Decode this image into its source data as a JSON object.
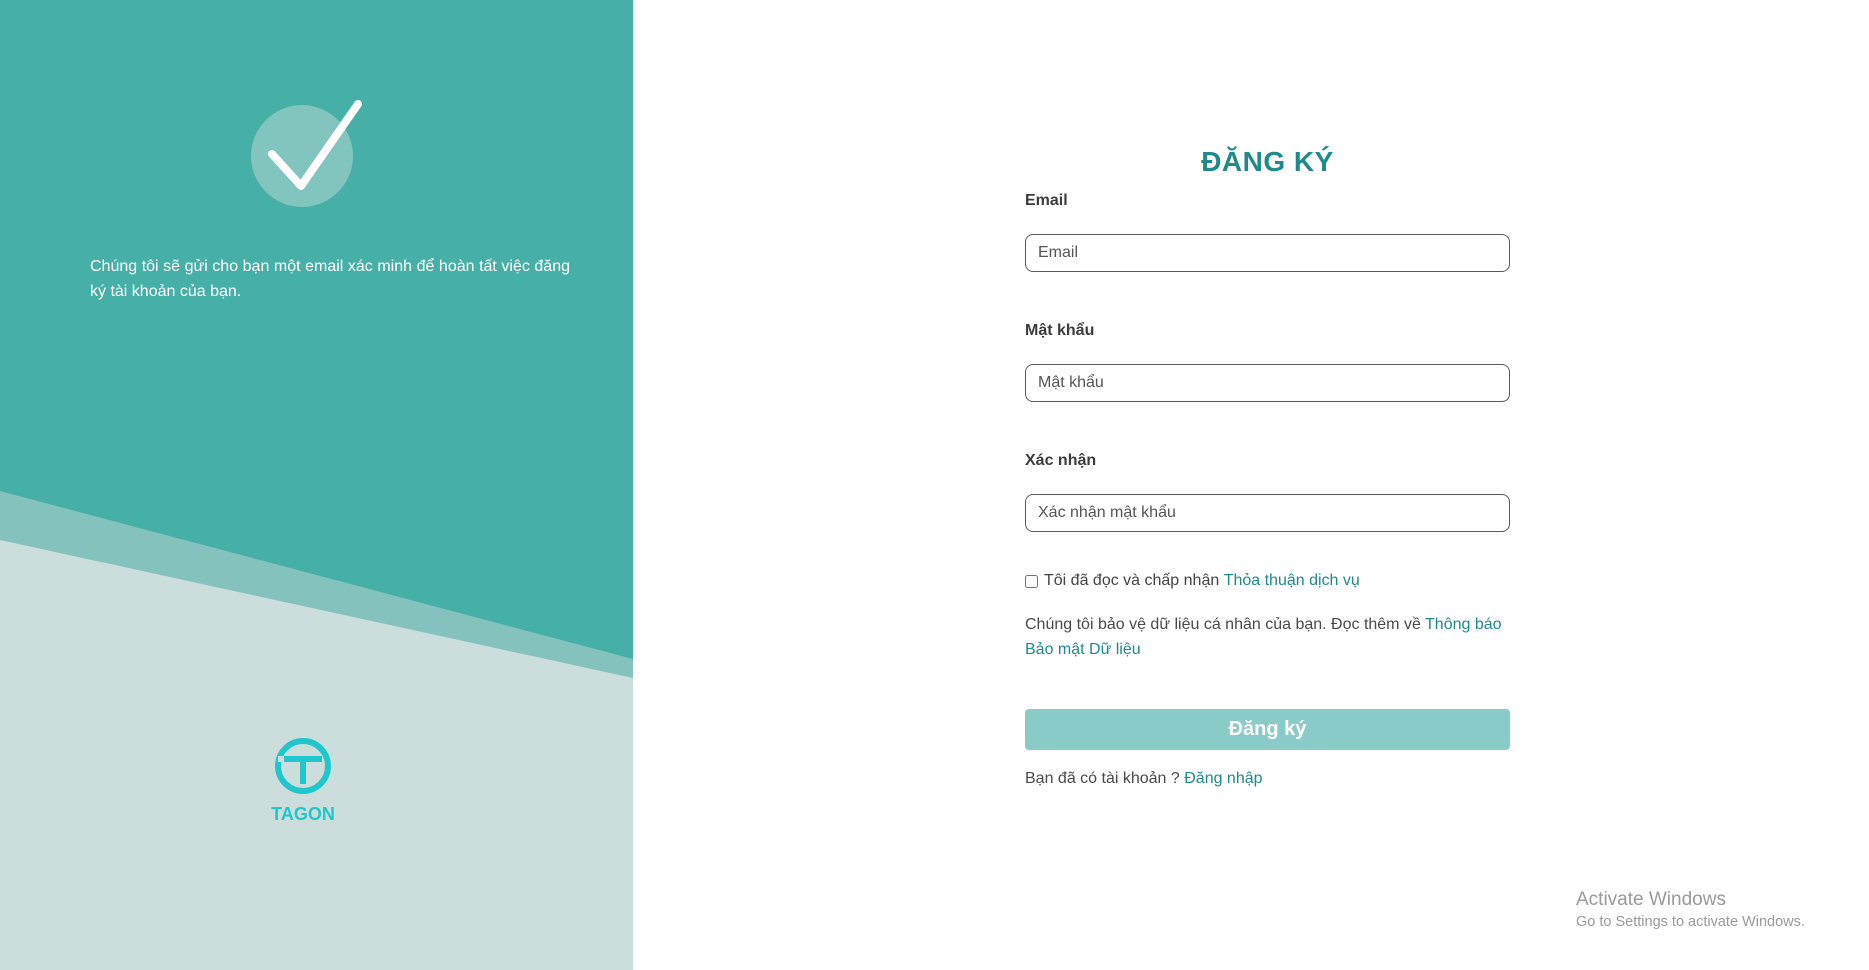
{
  "intro": {
    "message": "Chúng tôi sẽ gửi cho bạn một email xác minh để hoàn tất việc đăng ký tài khoản của bạn."
  },
  "brand": {
    "name": "TAGON",
    "icon": "tagon-logo-icon"
  },
  "form": {
    "title": "ĐĂNG KÝ",
    "email_label": "Email",
    "email_placeholder": "Email",
    "email_value": "",
    "password_label": "Mật khẩu",
    "password_placeholder": "Mật khẩu",
    "password_value": "",
    "confirm_label": "Xác nhận",
    "confirm_placeholder": "Xác nhận mật khẩu",
    "confirm_value": "",
    "terms_text": "Tôi đã đọc và chấp nhận ",
    "terms_link": "Thỏa thuận dịch vụ",
    "terms_checked": false,
    "privacy_text": "Chúng tôi bảo vệ dữ liệu cá nhân của bạn. Đọc thêm về ",
    "privacy_link": "Thông báo Bảo mật Dữ liệu",
    "submit_label": "Đăng ký",
    "login_prompt": "Bạn đã có tài khoản ? ",
    "login_link": "Đăng nhập"
  },
  "watermark": {
    "title": "Activate Windows",
    "subtitle": "Go to Settings to activate Windows."
  },
  "colors": {
    "panel_teal": "#46afa7",
    "panel_light": "#cbdedc",
    "panel_stripe": "#83c2bd",
    "accent": "#1e8a8c",
    "button": "#89cbc6",
    "logo": "#1fc6cc"
  }
}
